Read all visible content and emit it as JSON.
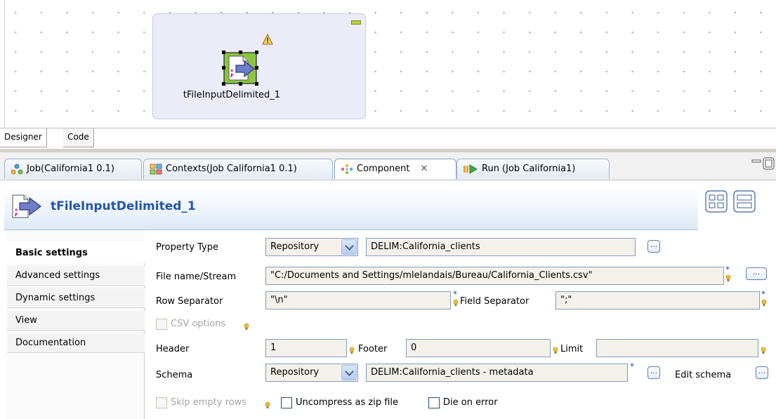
{
  "designer": {
    "component_label": "tFileInputDelimited_1"
  },
  "editor_tabs": [
    {
      "label": "Designer"
    },
    {
      "label": "Code"
    }
  ],
  "view_tabs": [
    {
      "label": "Job(California1 0.1)"
    },
    {
      "label": "Contexts(Job California1 0.1)"
    },
    {
      "label": "Component",
      "close": "✕"
    },
    {
      "label": "Run (Job California1)"
    }
  ],
  "component_view": {
    "title": "tFileInputDelimited_1"
  },
  "side_nav": [
    {
      "label": "Basic settings"
    },
    {
      "label": "Advanced settings"
    },
    {
      "label": "Dynamic settings"
    },
    {
      "label": "View"
    },
    {
      "label": "Documentation"
    }
  ],
  "form": {
    "property_type_label": "Property Type",
    "property_type_value": "Repository",
    "property_repo_value": "DELIM:California_clients",
    "file_label": "File name/Stream",
    "file_value": "\"C:/Documents and Settings/mlelandais/Bureau/California_Clients.csv\"",
    "row_sep_label": "Row Separator",
    "row_sep_value": "\"\\n\"",
    "field_sep_label": "Field Separator",
    "field_sep_value": "\";\"",
    "csv_options_label": "CSV options",
    "header_label": "Header",
    "header_value": "1",
    "footer_label": "Footer",
    "footer_value": "0",
    "limit_label": "Limit",
    "limit_value": "",
    "schema_label": "Schema",
    "schema_value": "Repository",
    "schema_repo_value": "DELIM:California_clients - metadata",
    "edit_schema_label": "Edit schema",
    "skip_empty_label": "Skip empty rows",
    "uncompress_label": "Uncompress as zip file",
    "die_on_error_label": "Die on error",
    "dots": "...",
    "required_mark": "*"
  },
  "colors": {
    "title": "#2456a8",
    "subjob_bg": "#ececf9",
    "field_bg": "#f4f1ea"
  }
}
